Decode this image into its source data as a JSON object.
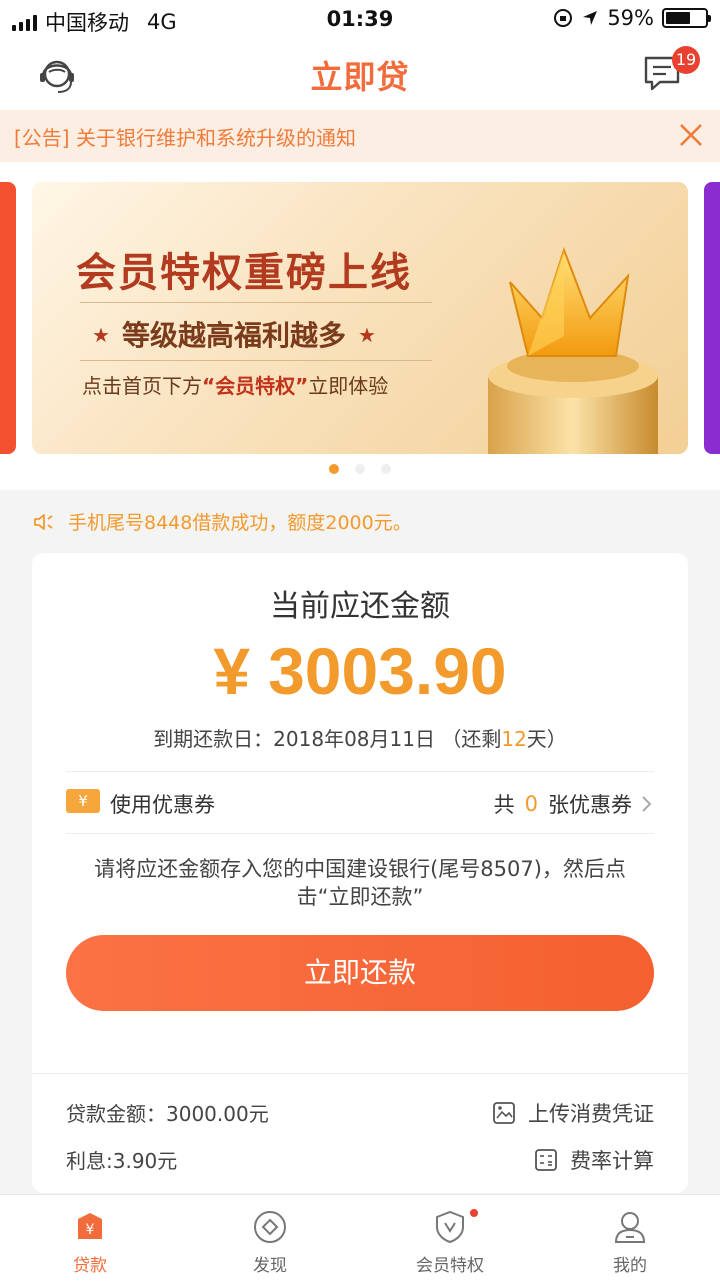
{
  "status_bar": {
    "carrier": "中国移动",
    "network": "4G",
    "time": "01:39",
    "battery": "59%",
    "battery_level": 0.59
  },
  "header": {
    "title": "立即贷",
    "message_badge": "19"
  },
  "notice": {
    "text": "[公告] 关于银行维护和系统升级的通知"
  },
  "banner": {
    "headline": "会员特权重磅上线",
    "subline": "等级越高福利越多",
    "cta_prefix": "点击首页下方",
    "cta_highlight": "“会员特权”",
    "cta_suffix": "立即体验",
    "slide_count": 3,
    "active_index": 0
  },
  "ticker": {
    "text": "手机尾号8448借款成功，额度2000元。"
  },
  "repayment": {
    "label": "当前应还金额",
    "currency_symbol": "¥",
    "amount": "3003.90",
    "due_prefix": "到期还款日：2018年08月11日 （还剩",
    "days_left": "12",
    "due_suffix": "天）",
    "coupon_icon_text": "¥",
    "coupon_label": "使用优惠券",
    "coupon_count_prefix": "共",
    "coupon_count": "0",
    "coupon_count_suffix": "张优惠券",
    "instruction": "请将应还金额存入您的中国建设银行(尾号8507)，然后点击“立即还款”",
    "button": "立即还款"
  },
  "loan_info": {
    "loan_amount": "贷款金额：3000.00元",
    "interest": "利息:3.90元",
    "upload_label": "上传消费凭证",
    "rate_calc_label": "费率计算"
  },
  "tabs": [
    {
      "label": "贷款",
      "active": true
    },
    {
      "label": "发现",
      "active": false
    },
    {
      "label": "会员特权",
      "active": false
    },
    {
      "label": "我的",
      "active": false
    }
  ],
  "colors": {
    "accent": "#f26b3a",
    "amount": "#f39a2c",
    "badge": "#e8412f"
  }
}
